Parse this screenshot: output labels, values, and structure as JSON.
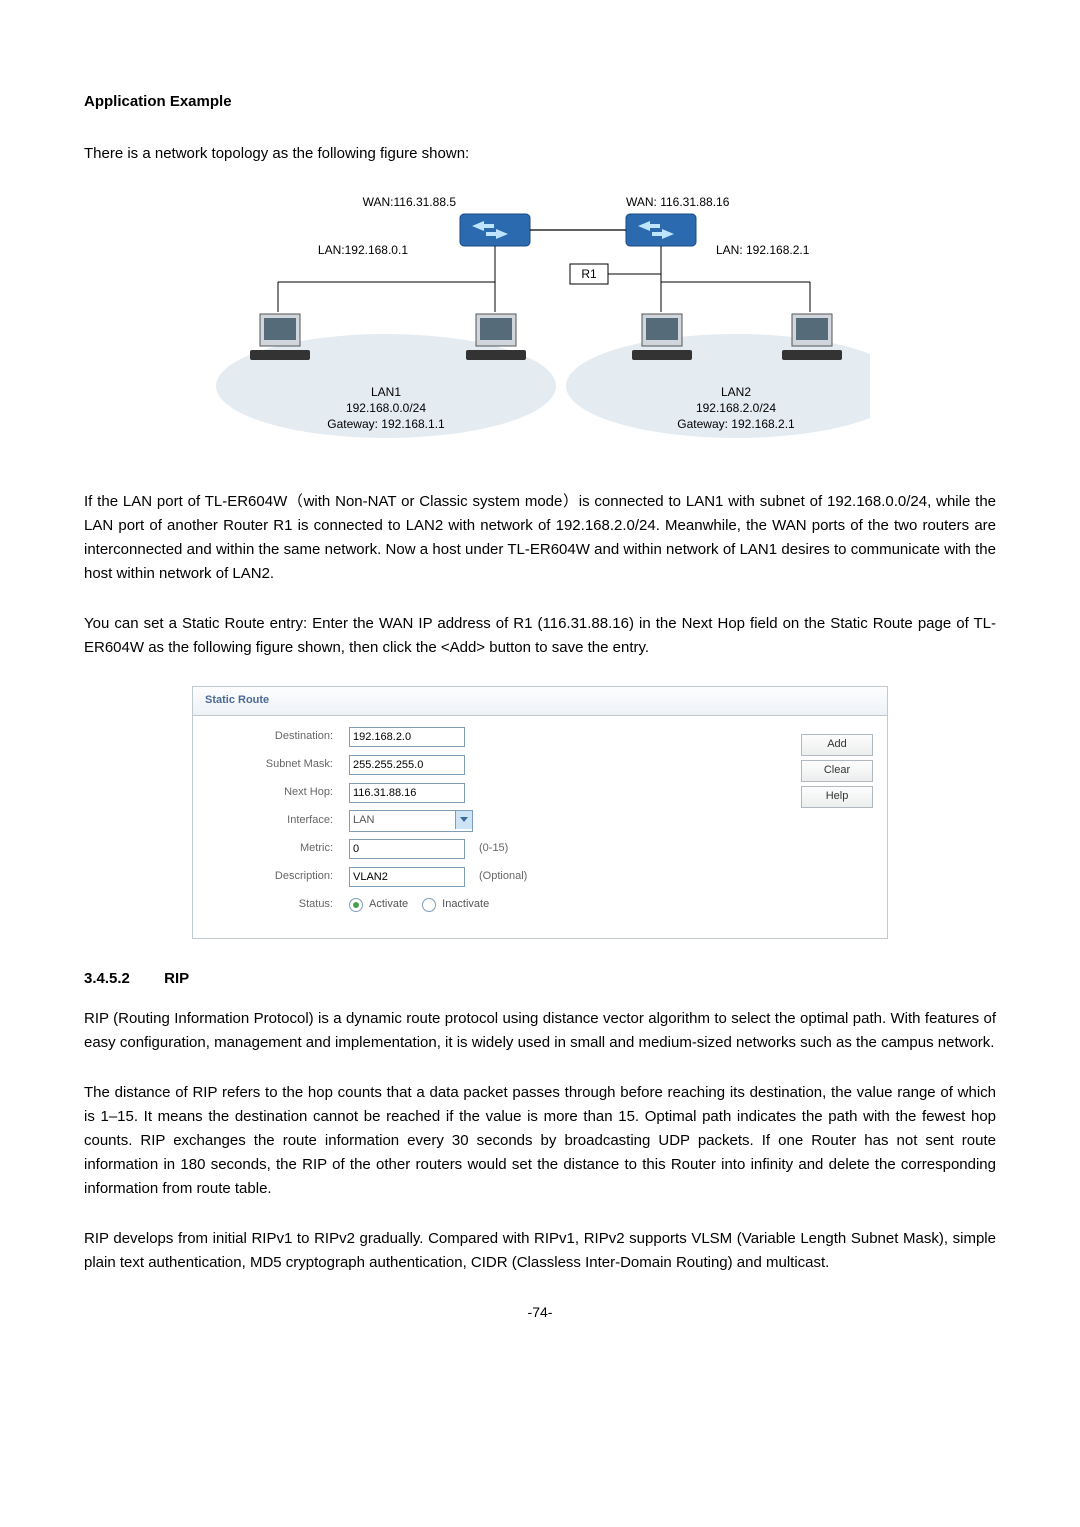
{
  "page": {
    "app_example_heading": "Application Example",
    "intro_text": "There is a network topology as the following figure shown:",
    "diagram": {
      "wan_left": "WAN:116.31.88.5",
      "wan_right": "WAN: 116.31.88.16",
      "lan_left": "LAN:192.168.0.1",
      "lan_right": "LAN: 192.168.2.1",
      "r1_label": "R1",
      "lan1_small": "LAN1",
      "lan1_net": "192.168.0.0/24",
      "lan1_gw": "Gateway: 192.168.1.1",
      "lan2_small": "LAN2",
      "lan2_net": "192.168.2.0/24",
      "lan2_gw": "Gateway: 192.168.2.1"
    },
    "para1": "If the LAN port of TL-ER604W（with Non-NAT or Classic system mode）is connected to LAN1 with subnet of 192.168.0.0/24, while the LAN port of another Router R1 is connected to LAN2 with network of 192.168.2.0/24. Meanwhile, the WAN ports of the two routers are interconnected and within the same network. Now a host under TL-ER604W and within network of LAN1 desires to communicate with the host within network of LAN2.",
    "para2": "You can set a Static Route entry: Enter the WAN IP address of R1 (116.31.88.16) in the Next Hop field on the Static Route page of TL-ER604W as the following figure shown, then click the <Add> button to save the entry.",
    "static_route": {
      "panel_title": "Static Route",
      "labels": {
        "destination": "Destination:",
        "subnet": "Subnet Mask:",
        "nexthop": "Next Hop:",
        "interface": "Interface:",
        "metric": "Metric:",
        "description": "Description:",
        "status": "Status:"
      },
      "values": {
        "destination": "192.168.2.0",
        "subnet": "255.255.255.0",
        "nexthop": "116.31.88.16",
        "interface": "LAN",
        "metric": "0",
        "metric_hint": "(0-15)",
        "description": "VLAN2",
        "description_hint": "(Optional)",
        "activate": "Activate",
        "inactivate": "Inactivate"
      },
      "buttons": {
        "add": "Add",
        "clear": "Clear",
        "help": "Help"
      }
    },
    "section_number": "3.4.5.2",
    "section_title": "RIP",
    "rip_p1": "RIP (Routing Information Protocol) is a dynamic route protocol using distance vector algorithm to select the optimal path. With features of easy configuration, management and implementation, it is widely used in small and medium-sized networks such as the campus network.",
    "rip_p2": "The distance of RIP refers to the hop counts that a data packet passes through before reaching its destination, the value range of which is 1–15. It means the destination cannot be reached if the value is more than 15. Optimal path indicates the path with the fewest hop counts. RIP exchanges the route information every 30 seconds by broadcasting UDP packets. If one Router has not sent route information in 180 seconds, the RIP of the other routers would set the distance to this Router into infinity and delete the corresponding information from route table.",
    "rip_p3": "RIP develops from initial RIPv1 to RIPv2 gradually. Compared with RIPv1, RIPv2 supports VLSM (Variable Length Subnet Mask), simple plain text authentication, MD5 cryptograph authentication, CIDR (Classless Inter-Domain Routing) and multicast.",
    "page_number": "-74-"
  }
}
